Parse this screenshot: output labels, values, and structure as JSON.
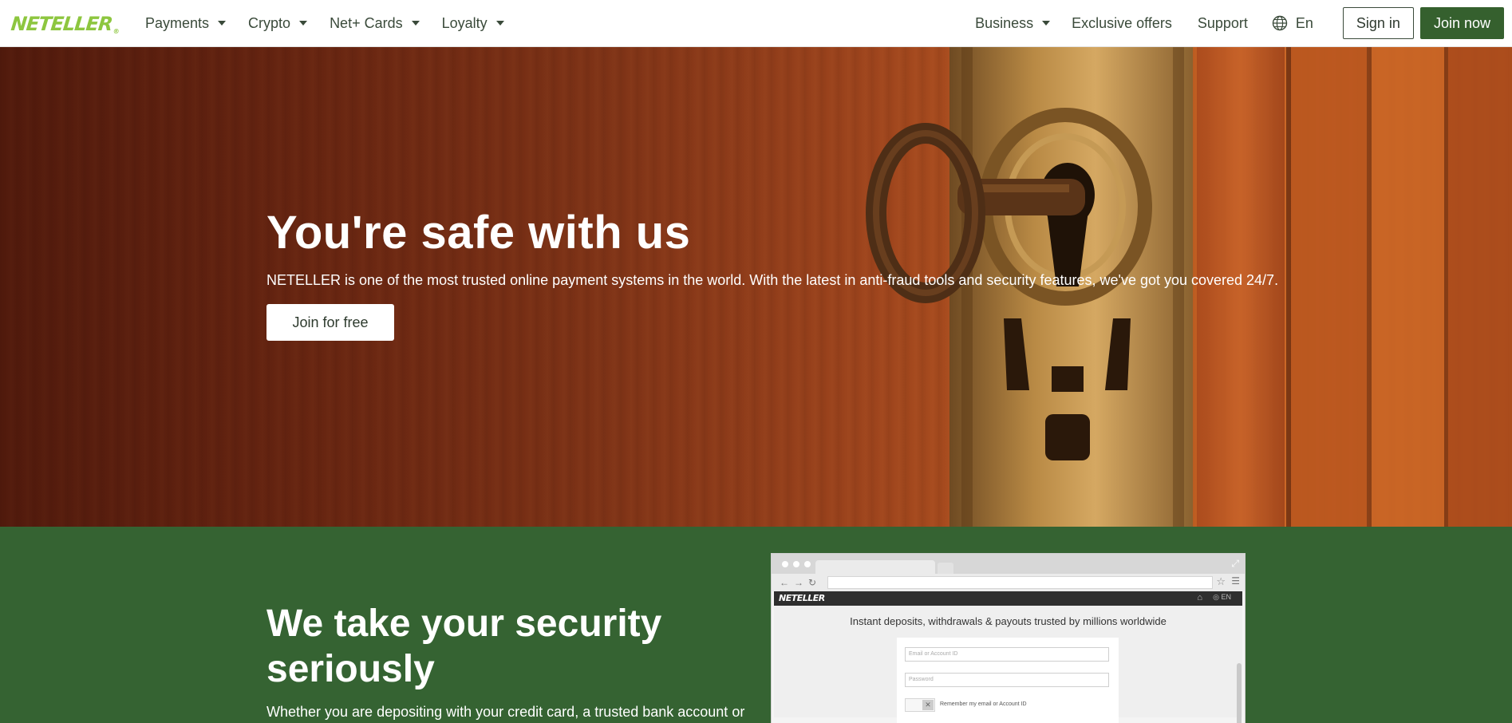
{
  "header": {
    "logo": "NETELLER",
    "logo_mark": "®",
    "nav_left": [
      {
        "label": "Payments",
        "icon": "chevron-down-icon"
      },
      {
        "label": "Crypto",
        "icon": "chevron-down-icon"
      },
      {
        "label": "Net+ Cards",
        "icon": "chevron-down-icon"
      },
      {
        "label": "Loyalty",
        "icon": "chevron-down-icon"
      }
    ],
    "nav_right": {
      "business": "Business",
      "exclusive_offers": "Exclusive offers",
      "support": "Support",
      "language": "En",
      "sign_in": "Sign in",
      "join_now": "Join now"
    }
  },
  "hero": {
    "title": "You're safe with us",
    "subtitle": "NETELLER is one of the most trusted online payment systems in the world. With the latest in anti-fraud tools and security features, we've got you covered 24/7.",
    "cta": "Join for free"
  },
  "security": {
    "title": "We take your security seriously",
    "body": "Whether you are depositing with your credit card, a trusted bank account or",
    "browser_mockup": {
      "logo": "NETELLER",
      "tagline": "Instant deposits, withdrawals & payouts trusted by millions worldwide",
      "email_placeholder": "Email or Account ID",
      "password_placeholder": "Password",
      "remember": "Remember my email or Account ID",
      "lang": "EN"
    }
  },
  "colors": {
    "brand_green": "#8dc63f",
    "dark_green": "#356332",
    "button_green": "#35602e"
  }
}
